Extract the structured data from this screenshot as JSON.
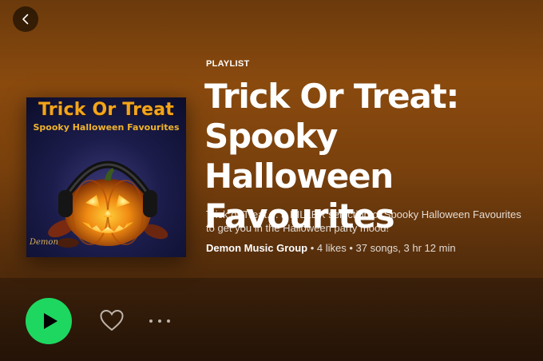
{
  "navigation": {
    "back_icon": "chevron-left-icon"
  },
  "cover": {
    "title": "Trick Or Treat",
    "subtitle": "Spooky Halloween Favourites",
    "logo_text": "Demon"
  },
  "playlist": {
    "type_label": "PLAYLIST",
    "title": "Trick Or Treat: Spooky Halloween Favourites",
    "description": "Trick or Treat.... a KILLER selection of Spooky Halloween Favourites to get you in the Halloween party mood!",
    "owner": "Demon Music Group",
    "likes": "4 likes",
    "songs_duration": "37 songs, 3 hr 12 min",
    "separator": " • "
  },
  "actions": {
    "play_icon": "play-icon",
    "like_icon": "heart-icon",
    "more_icon": "more-dots-icon"
  },
  "colors": {
    "hero": "#8a4a0e",
    "play_button": "#1ed760",
    "cover_title": "#f3a51a"
  }
}
